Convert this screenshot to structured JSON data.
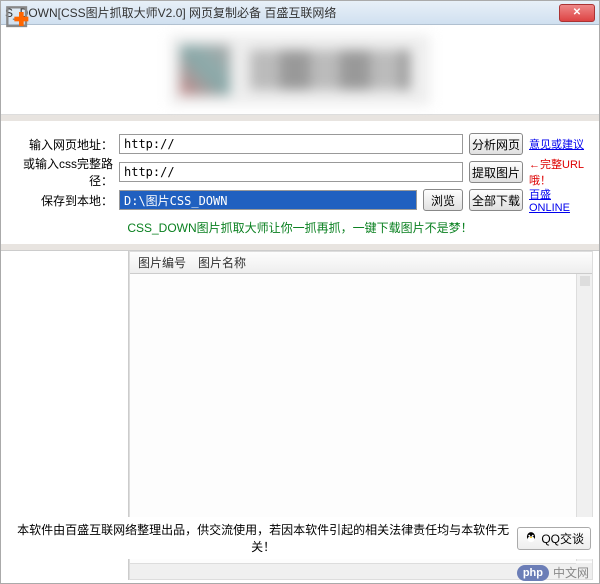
{
  "window": {
    "title": "S_DOWN[CSS图片抓取大师V2.0] 网页复制必备 百盛互联网络",
    "close": "✕"
  },
  "form": {
    "url_label": "输入网页地址：",
    "url_value": "http://",
    "analyze_btn": "分析网页",
    "feedback_link": "意见或建议",
    "css_label": "或输入css完整路径：",
    "css_value": "http://",
    "extract_btn": "提取图片",
    "url_note": "←完整URL哦！",
    "save_label": "保存到本地：",
    "save_value": "D:\\图片CSS_DOWN",
    "browse_btn": "浏览",
    "download_all_btn": "全部下载",
    "online_link": "百盛ONLINE"
  },
  "slogan": "CSS_DOWN图片抓取大师让你一抓再抓，一键下载图片不是梦！",
  "list": {
    "col1": "图片编号",
    "col2": "图片名称"
  },
  "footer": {
    "text": "本软件由百盛互联网络整理出品，供交流使用，若因本软件引起的相关法律责任均与本软件无关！",
    "qq": "QQ交谈"
  },
  "watermark": {
    "logo": "php",
    "text": "中文网"
  }
}
